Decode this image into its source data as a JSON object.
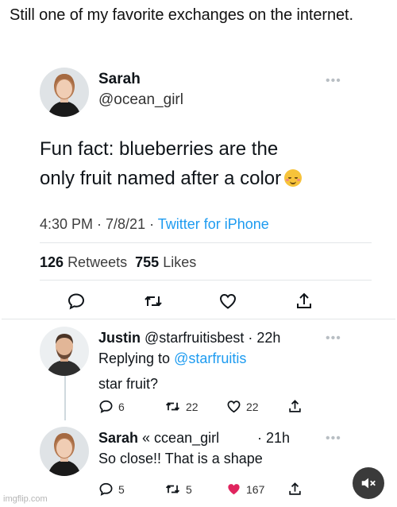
{
  "caption": "Still one of my favorite exchanges on the internet.",
  "main_tweet": {
    "author_name": "Sarah",
    "author_handle": "@ocean_girl",
    "text_line1": "Fun fact: blueberries are the",
    "text_line2": "only fruit named after a color",
    "emoji": "smiling-blush-emoji",
    "time": "4:30 PM · 7/8/21 · ",
    "source": "Twitter for iPhone",
    "retweets_count": "126",
    "retweets_label": "Retweets",
    "likes_count": "755",
    "likes_label": "Likes"
  },
  "reply1": {
    "author_name": "Justin",
    "author_handle": "@starfruitisbest",
    "time": "· 22h",
    "replying_prefix": "Replying to",
    "replying_to": "@starfruitis",
    "text": "star fruit?",
    "reply_count": "6",
    "retweet_count": "22",
    "like_count": "22"
  },
  "reply2": {
    "author_name": "Sarah",
    "author_handle": "« ccean_girl",
    "time": "· 21h",
    "text": "So close!! That is a shape",
    "reply_count": "5",
    "retweet_count": "5",
    "like_count": "167"
  },
  "more_glyph": "•••",
  "watermark": "imgflip.com",
  "colors": {
    "link": "#1d9bf0",
    "liked_heart": "#e0245e",
    "divider": "#e3e6e8"
  },
  "icons": [
    "reply-icon",
    "retweet-icon",
    "like-icon",
    "share-icon",
    "mute-icon",
    "more-icon"
  ]
}
